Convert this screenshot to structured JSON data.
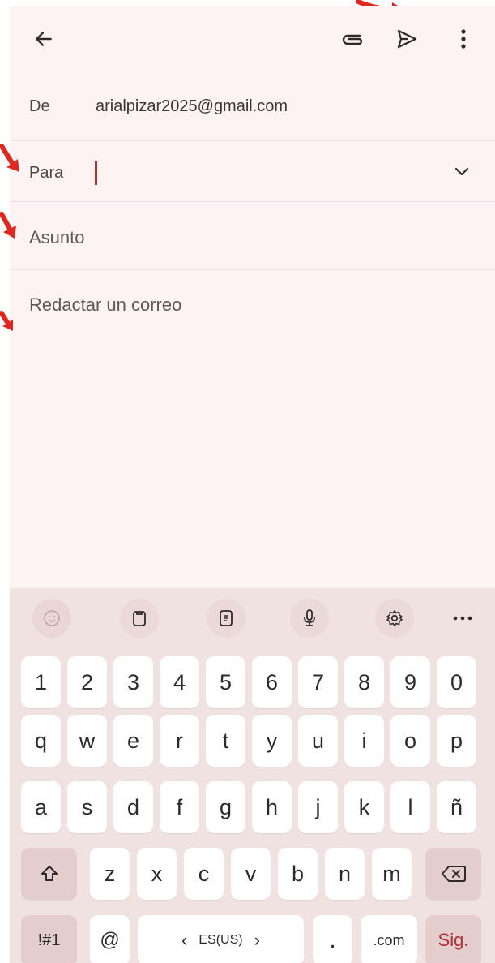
{
  "header": {
    "back_icon": "arrow-left-icon",
    "attach_icon": "paperclip-icon",
    "send_icon": "send-icon",
    "more_icon": "more-vertical-icon"
  },
  "compose": {
    "from_label": "De",
    "from_value": "arialpizar2025@gmail.com",
    "to_label": "Para",
    "to_value": "",
    "subject_placeholder": "Asunto",
    "body_placeholder": "Redactar un correo"
  },
  "keyboard": {
    "toolbar": [
      "emoji-icon",
      "clipboard-icon",
      "text-extract-icon",
      "microphone-icon",
      "settings-icon",
      "more-horizontal-icon"
    ],
    "number_row": [
      "1",
      "2",
      "3",
      "4",
      "5",
      "6",
      "7",
      "8",
      "9",
      "0"
    ],
    "row1": [
      "q",
      "w",
      "e",
      "r",
      "t",
      "y",
      "u",
      "i",
      "o",
      "p"
    ],
    "row2": [
      "a",
      "s",
      "d",
      "f",
      "g",
      "h",
      "j",
      "k",
      "l",
      "ñ"
    ],
    "row3": [
      "z",
      "x",
      "c",
      "v",
      "b",
      "n",
      "m"
    ],
    "symbols_key": "!#1",
    "at_key": "@",
    "space_lang": "ES(US)",
    "space_left": "‹",
    "space_right": "›",
    "period_key": ".",
    "dotcom_key": ".com",
    "next_key": "Sig."
  },
  "colors": {
    "background": "#fcf3f2",
    "keyboard_bg": "#f1e2e2",
    "accent_red": "#b32d3a",
    "annotation_red": "#e0281e"
  }
}
